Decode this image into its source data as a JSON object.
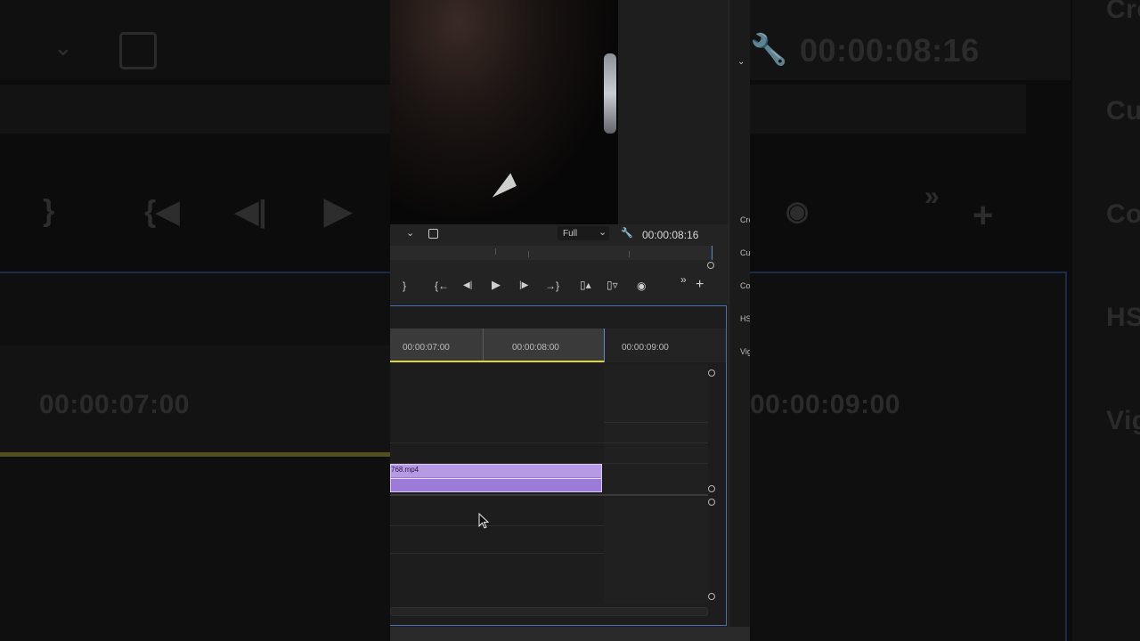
{
  "program": {
    "timecode": "00:00:08:16",
    "fit_option": "Full",
    "ruler_ticks": [
      "00:00:07:00",
      "00:00:08:00",
      "00:00:09:00"
    ],
    "clip_name": "768.mp4",
    "side_labels": [
      "Cre",
      "Cu",
      "Co",
      "HS",
      "Vig"
    ]
  },
  "background": {
    "timecode": "00:00:08:16",
    "ruler_left": "00:00:07:00",
    "ruler_right": "00:00:09:00",
    "right_labels": [
      "Cre",
      "Cur",
      "Col",
      "HS",
      "Vig"
    ]
  },
  "icons": {
    "wrench": "wrench-icon",
    "camera": "camera-icon",
    "play": "play-icon",
    "step_back": "step-back-icon",
    "step_forward": "step-forward-icon",
    "go_to_in": "go-to-in-icon",
    "go_to_out": "go-to-out-icon",
    "lift": "lift-icon",
    "extract": "extract-icon",
    "more": "chevrons-right-icon",
    "add": "plus-icon",
    "dropdown": "chevron-down-icon",
    "settings": "settings-icon",
    "cursor": "cursor-icon"
  },
  "colors": {
    "clip": "#9b7ad8",
    "playhead_bar": "#d9d93a",
    "panel_border": "#4a6fb6"
  }
}
